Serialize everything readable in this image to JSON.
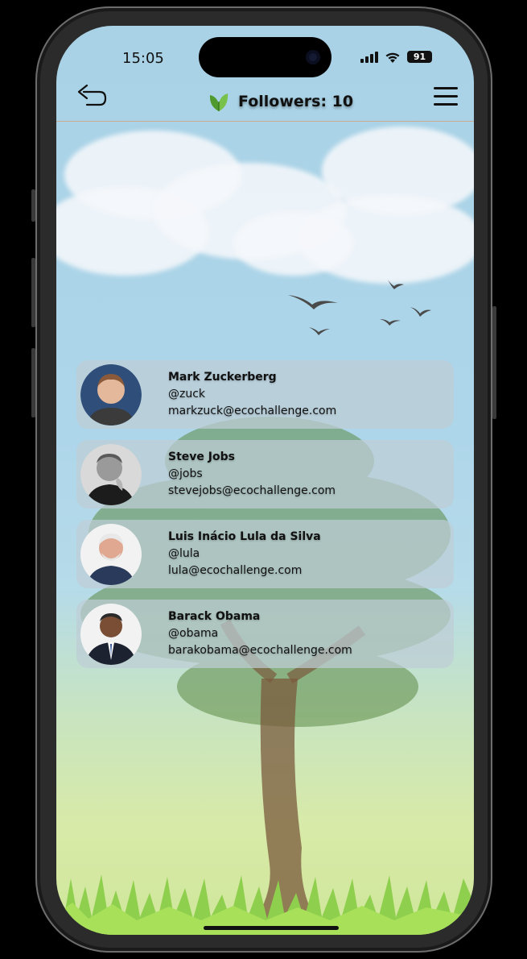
{
  "status_bar": {
    "time": "15:05",
    "battery": "91",
    "icons": [
      "signal-icon",
      "wifi-icon",
      "battery-icon"
    ]
  },
  "header": {
    "back_icon": "undo-arrow-icon",
    "logo_icon": "leaf-icon",
    "title": "Followers: 10",
    "menu_icon": "hamburger-menu-icon"
  },
  "followers": [
    {
      "name": "Mark Zuckerberg",
      "handle": "@zuck",
      "email": "markzuck@ecochallenge.com"
    },
    {
      "name": "Steve Jobs",
      "handle": "@jobs",
      "email": "stevejobs@ecochallenge.com"
    },
    {
      "name": "Luis Inácio Lula da Silva",
      "handle": "@lula",
      "email": "lula@ecochallenge.com"
    },
    {
      "name": "Barack Obama",
      "handle": "@obama",
      "email": "barakobama@ecochallenge.com"
    }
  ],
  "colors": {
    "sky": "#aed6ea",
    "card": "#becdd6",
    "header_divider": "#c9a98f",
    "leaf_green": "#5fae3a"
  }
}
